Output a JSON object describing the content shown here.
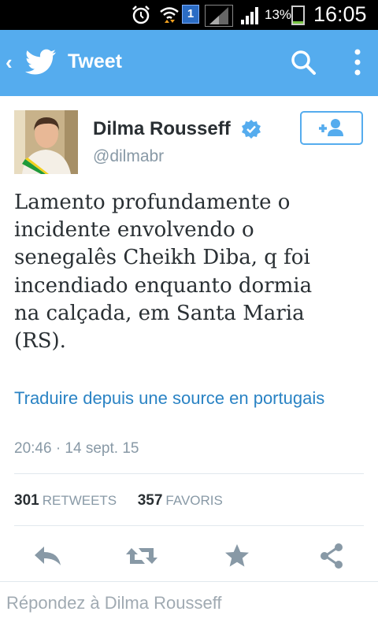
{
  "status_bar": {
    "notification_count": "1",
    "battery_percent": "13%",
    "battery_level": 0.13,
    "time": "16:05",
    "icons": [
      "alarm-icon",
      "wifi-icon",
      "notification-icon",
      "signal-icon",
      "signal-icon",
      "battery-icon"
    ]
  },
  "app_bar": {
    "title": "Tweet",
    "back_icon": "chevron-left-icon",
    "logo_icon": "twitter-bird-icon",
    "search_icon": "search-icon",
    "more_icon": "more-vertical-icon",
    "color": "#55acee"
  },
  "tweet": {
    "author_name": "Dilma Rousseff",
    "author_handle": "@dilmabr",
    "verified_icon": "verified-badge-icon",
    "follow_icon": "add-user-icon",
    "lines": [
      "Lamento profundamente o",
      "incidente envolvendo o",
      "senegalês Cheikh Diba, q foi",
      "incendiado enquanto dormia",
      "na calçada, em Santa Maria",
      "(RS)."
    ],
    "translate_link": "Traduire depuis une source en portugais",
    "timestamp": "20:46 · 14 sept. 15",
    "retweets_count": "301",
    "retweets_label": "RETWEETS",
    "favorites_count": "357",
    "favorites_label": "FAVORIS",
    "link_color": "#2a83c4"
  },
  "actions": {
    "icons": [
      "reply-icon",
      "retweet-icon",
      "favorite-icon",
      "share-icon"
    ]
  },
  "reply": {
    "placeholder": "Répondez à Dilma Rousseff"
  }
}
